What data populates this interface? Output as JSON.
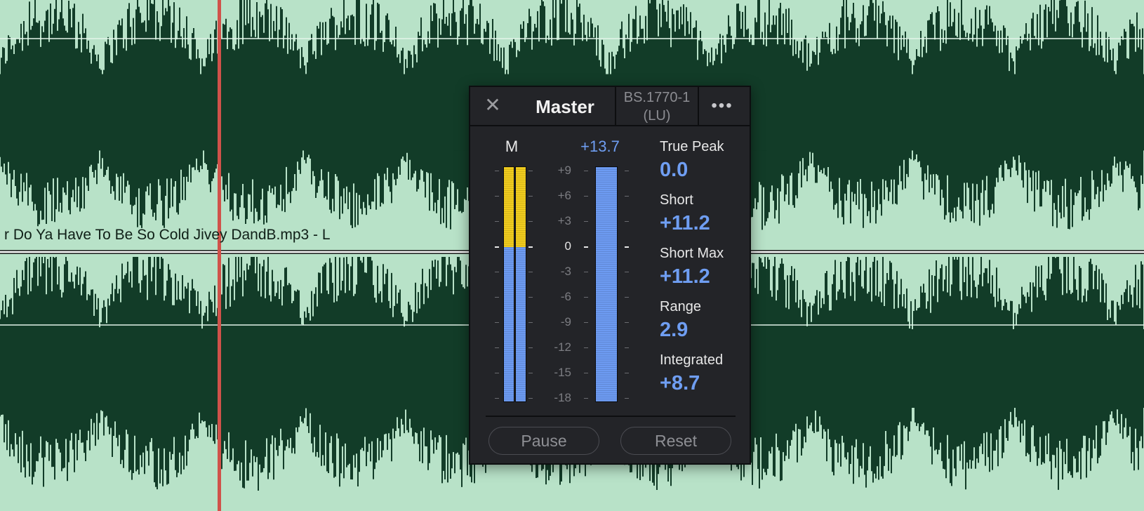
{
  "track": {
    "clip_label": "r Do Ya Have To Be So Cold Jivey DandB.mp3 - L",
    "waveform_color": "#123c28",
    "background_color": "#b8e2c8",
    "playhead_color": "#d0524a"
  },
  "meter_panel": {
    "close_icon": "close-icon",
    "title": "Master",
    "standard_line1": "BS.1770-1",
    "standard_line2": "(LU)",
    "more_icon": "more-dots-icon",
    "more_glyph": "•••",
    "channel_label": "M",
    "peak_label": "+13.7",
    "scale": [
      "+9",
      "+6",
      "+3",
      "0",
      "-3",
      "-6",
      "-9",
      "-12",
      "-15",
      "-18"
    ],
    "left_channel_level_fraction": 0.34,
    "right_channel_level_fraction": 0.34,
    "loudness_bar_level_fraction": 1.0,
    "stats": [
      {
        "label": "True Peak",
        "value": "0.0"
      },
      {
        "label": "Short",
        "value": "+11.2"
      },
      {
        "label": "Short Max",
        "value": "+11.2"
      },
      {
        "label": "Range",
        "value": "2.9"
      },
      {
        "label": "Integrated",
        "value": "+8.7"
      }
    ],
    "pause_label": "Pause",
    "reset_label": "Reset",
    "accent_color": "#6f9ef2",
    "over_color": "#f0cc1e"
  }
}
